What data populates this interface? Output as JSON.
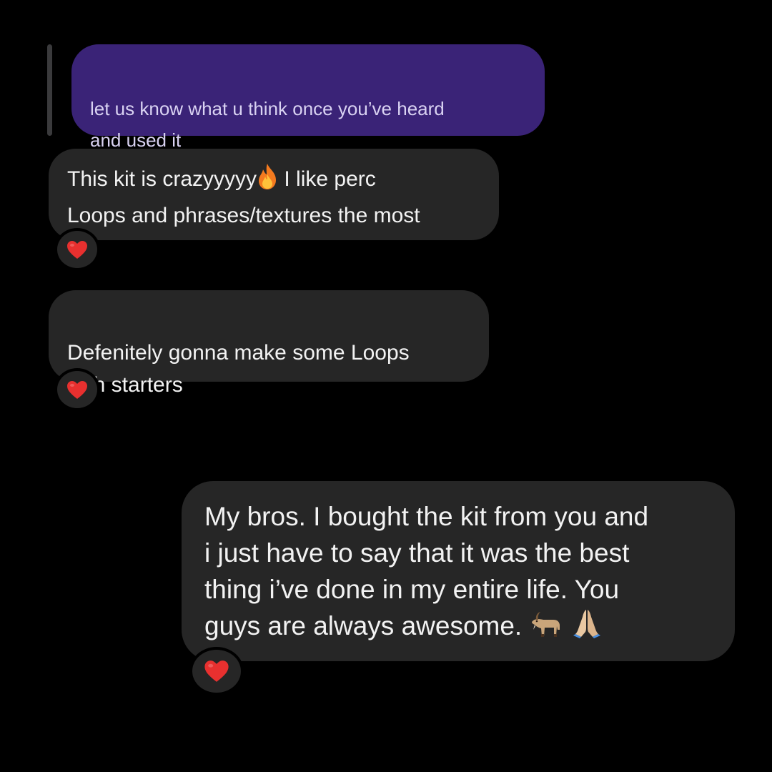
{
  "messages": [
    {
      "id": "quoted",
      "direction": "sent",
      "text": "let us know what u think once you’ve heard\nand used it",
      "color": "#3a2377"
    },
    {
      "id": "recv1",
      "direction": "received",
      "text_before_emoji": "This kit is crazyyyyy",
      "emoji": "fire-icon",
      "text_after_emoji": "  I like perc\nLoops and phrases/textures the most",
      "reaction": "red-heart-icon"
    },
    {
      "id": "recv2",
      "direction": "received",
      "text": "Defenitely gonna make some Loops\nwith starters",
      "reaction": "red-heart-icon"
    },
    {
      "id": "sent1",
      "direction": "sent",
      "text": "My bros. I bought the kit from you and\ni just have to say that it was the best\nthing i’ve done in my entire life. You\nguys are always awesome.",
      "emojis": [
        "goat-icon",
        "folded-hands-icon"
      ],
      "reaction": "red-heart-icon"
    }
  ],
  "colors": {
    "background": "#000000",
    "bubble_received": "#262626",
    "bubble_quoted": "#3a2377",
    "heart": "#e8302f"
  }
}
